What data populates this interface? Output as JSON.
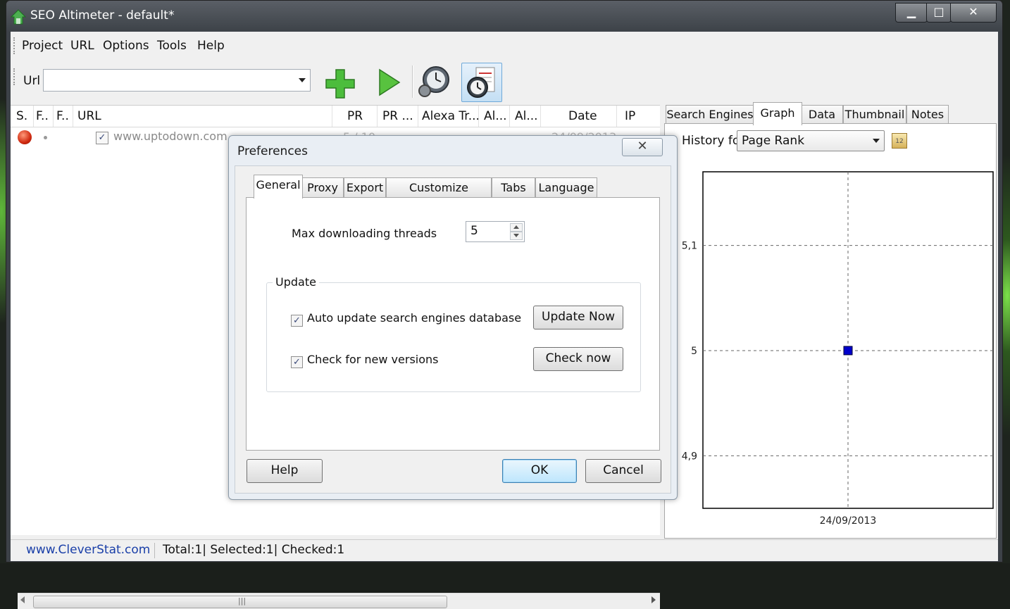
{
  "window": {
    "title": "SEO Altimeter - default*"
  },
  "menu": {
    "items": [
      "Project",
      "URL",
      "Options",
      "Tools",
      "Help"
    ]
  },
  "toolbar": {
    "url_label": "Url",
    "url_value": ""
  },
  "list": {
    "columns": [
      "S.",
      "F..",
      "F..",
      "URL",
      "PR",
      "PR ...",
      "Alexa Tr...",
      "Al...",
      "Al...",
      "Date",
      "IP"
    ],
    "rows": [
      {
        "url": "www.uptodown.com",
        "pr": "5 / 10",
        "date": "24/09/2013",
        "checked": true
      }
    ]
  },
  "right_tabs": [
    "Search Engines",
    "Graph",
    "Data",
    "Thumbnail",
    "Notes"
  ],
  "graph": {
    "history_label": "History for",
    "history_value": "Page Rank"
  },
  "chart_data": {
    "type": "scatter",
    "x": [
      "24/09/2013"
    ],
    "y": [
      5
    ],
    "yticks": [
      "5,1",
      "5",
      "4,9"
    ],
    "ylim": [
      4.85,
      5.17
    ],
    "grid": true,
    "marker_color": "#0000cc"
  },
  "status": {
    "link": "www.CleverStat.com",
    "counts": "Total:1|  Selected:1|  Checked:1"
  },
  "dialog": {
    "title": "Preferences",
    "tabs": [
      "General",
      "Proxy",
      "Export",
      "Customize columns",
      "Tabs",
      "Language"
    ],
    "threads_label": "Max downloading threads",
    "threads_value": "5",
    "group_label": "Update",
    "auto_update_label": "Auto update search engines database",
    "check_versions_label": "Check for new versions",
    "update_now": "Update Now",
    "check_now": "Check now",
    "help": "Help",
    "ok": "OK",
    "cancel": "Cancel"
  },
  "colors": {
    "link": "#1a3fa8",
    "marker": "#0000cc",
    "accent": "#3c7fb1"
  }
}
